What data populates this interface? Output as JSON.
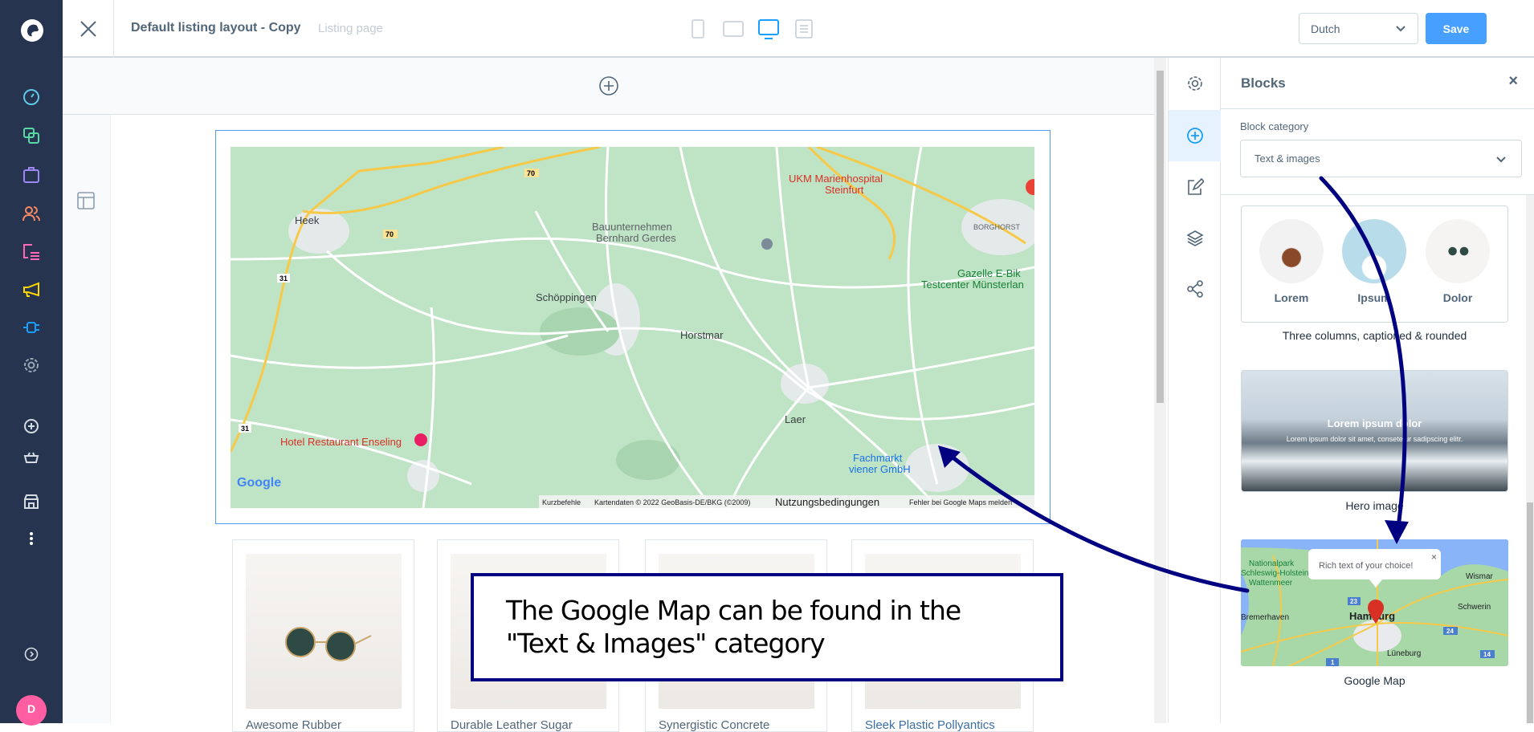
{
  "header": {
    "title": "Default listing layout - Copy",
    "subtitle": "Listing page",
    "language": "Dutch",
    "save_label": "Save",
    "devices": [
      "mobile-icon",
      "tablet-icon",
      "desktop-icon",
      "list-icon"
    ],
    "active_device": "desktop-icon"
  },
  "sidebar": {
    "items": [
      "dashboard-icon",
      "catalog-icon",
      "orders-icon",
      "customers-icon",
      "content-icon",
      "marketing-icon",
      "extensions-icon",
      "settings-icon",
      "add-icon",
      "basket-icon",
      "storefront-icon",
      "more-icon"
    ],
    "colors": [
      "#5fc8e8",
      "#57d9a3",
      "#9f88f5",
      "#f88962",
      "#ff68b4",
      "#ffd700",
      "#189eff",
      "#9aa8b5"
    ],
    "avatar": "D",
    "avatar_color": "#ff5fa2"
  },
  "panel": {
    "title": "Blocks",
    "category_label": "Block category",
    "category_value": "Text & images",
    "blocks": [
      {
        "caption": "Three columns, captioned & rounded",
        "columns": [
          "Lorem",
          "Ipsum",
          "Dolor"
        ]
      },
      {
        "caption": "Hero image",
        "hero_title": "Lorem ipsum dolor",
        "hero_text": "Lorem ipsum dolor sit amet, consetetur sadipscing elitr."
      },
      {
        "caption": "Google Map",
        "popup": "Rich text of your choice!",
        "places": [
          "Nationalpark",
          "Schleswig-Holstein",
          "Wattenmeer",
          "Wismar",
          "Schwerin",
          "Hamburg",
          "Bremerhaven",
          "Lüneburg"
        ],
        "roads": [
          "23",
          "24",
          "1",
          "14"
        ]
      }
    ]
  },
  "map": {
    "places": [
      "Heek",
      "Schöppingen",
      "Horstmar",
      "Laer",
      "Bauunternehmen",
      "Bernhard Gerdes",
      "UKM Marienhospital",
      "Steinfurt",
      "BORGHORST",
      "Gazelle E-Bik",
      "Testcenter Münsterlan",
      "Hotel Restaurant Enseling",
      "Fachmarkt",
      "viener GmbH"
    ],
    "roads": [
      "70",
      "70",
      "31",
      "31"
    ],
    "logo": "Google",
    "attribution": {
      "shortcuts": "Kurzbefehle",
      "data": "Kartendaten © 2022 GeoBasis-DE/BKG (©2009)",
      "terms": "Nutzungsbedingungen",
      "report": "Fehler bei Google Maps melden"
    }
  },
  "products": [
    "Awesome Rubber",
    "Durable Leather Sugar",
    "Synergistic Concrete",
    "Sleek Plastic Pollyantics"
  ],
  "annotation": {
    "line1": "The Google Map can be found in the",
    "line2": "\"Text & Images\" category",
    "color": "#000080"
  }
}
